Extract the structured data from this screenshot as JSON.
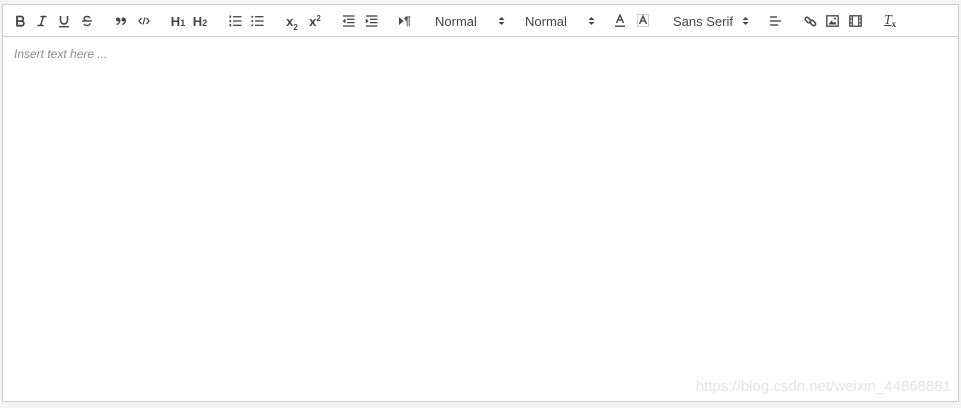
{
  "toolbar": {
    "heading1_label": "H",
    "heading1_sub": "1",
    "heading2_label": "H",
    "heading2_sub": "2",
    "subscript_label": "x",
    "subscript_mark": "2",
    "superscript_label": "x",
    "superscript_mark": "2",
    "direction_label": "¶",
    "size_picker": "Normal",
    "header_picker": "Normal",
    "font_picker": "Sans Serif",
    "clean_label": "T",
    "clean_sub": "x"
  },
  "editor": {
    "placeholder": "Insert text here ..."
  },
  "watermark": "https://blog.csdn.net/weixin_44868881",
  "colors": {
    "icon": "#444444",
    "border": "#cccccc",
    "placeholder": "#8a8a8a"
  }
}
